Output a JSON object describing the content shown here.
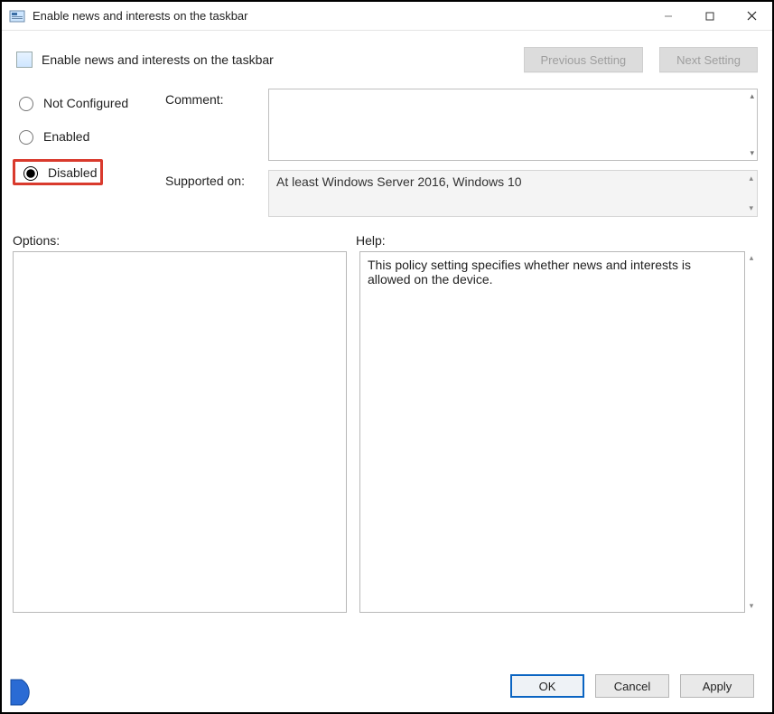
{
  "window": {
    "title": "Enable news and interests on the taskbar"
  },
  "header": {
    "policy_title": "Enable news and interests on the taskbar",
    "prev_button": "Previous Setting",
    "next_button": "Next Setting"
  },
  "radios": {
    "not_configured": "Not Configured",
    "enabled": "Enabled",
    "disabled": "Disabled",
    "selected": "disabled"
  },
  "labels": {
    "comment": "Comment:",
    "supported_on": "Supported on:",
    "options": "Options:",
    "help": "Help:"
  },
  "supported_on_text": "At least Windows Server 2016, Windows 10",
  "help_text": "This policy setting specifies whether news and interests is allowed on the device.",
  "buttons": {
    "ok": "OK",
    "cancel": "Cancel",
    "apply": "Apply"
  }
}
